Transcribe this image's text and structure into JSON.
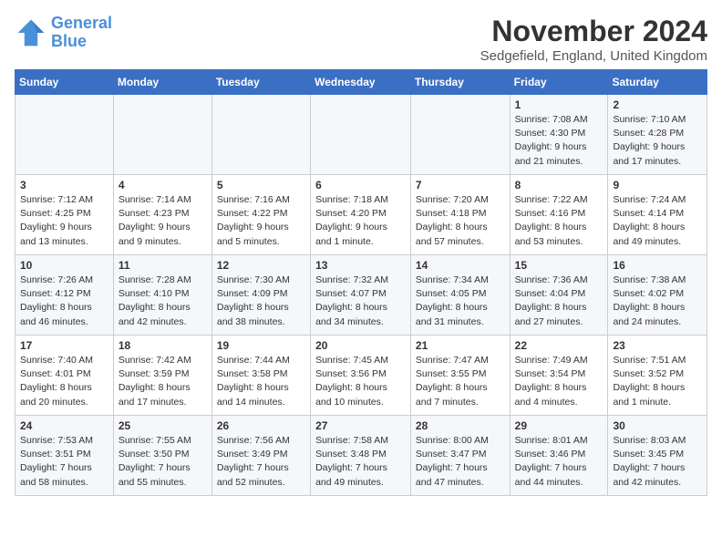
{
  "logo": {
    "line1": "General",
    "line2": "Blue"
  },
  "title": "November 2024",
  "location": "Sedgefield, England, United Kingdom",
  "days_header": [
    "Sunday",
    "Monday",
    "Tuesday",
    "Wednesday",
    "Thursday",
    "Friday",
    "Saturday"
  ],
  "weeks": [
    [
      {
        "day": "",
        "info": ""
      },
      {
        "day": "",
        "info": ""
      },
      {
        "day": "",
        "info": ""
      },
      {
        "day": "",
        "info": ""
      },
      {
        "day": "",
        "info": ""
      },
      {
        "day": "1",
        "info": "Sunrise: 7:08 AM\nSunset: 4:30 PM\nDaylight: 9 hours\nand 21 minutes."
      },
      {
        "day": "2",
        "info": "Sunrise: 7:10 AM\nSunset: 4:28 PM\nDaylight: 9 hours\nand 17 minutes."
      }
    ],
    [
      {
        "day": "3",
        "info": "Sunrise: 7:12 AM\nSunset: 4:25 PM\nDaylight: 9 hours\nand 13 minutes."
      },
      {
        "day": "4",
        "info": "Sunrise: 7:14 AM\nSunset: 4:23 PM\nDaylight: 9 hours\nand 9 minutes."
      },
      {
        "day": "5",
        "info": "Sunrise: 7:16 AM\nSunset: 4:22 PM\nDaylight: 9 hours\nand 5 minutes."
      },
      {
        "day": "6",
        "info": "Sunrise: 7:18 AM\nSunset: 4:20 PM\nDaylight: 9 hours\nand 1 minute."
      },
      {
        "day": "7",
        "info": "Sunrise: 7:20 AM\nSunset: 4:18 PM\nDaylight: 8 hours\nand 57 minutes."
      },
      {
        "day": "8",
        "info": "Sunrise: 7:22 AM\nSunset: 4:16 PM\nDaylight: 8 hours\nand 53 minutes."
      },
      {
        "day": "9",
        "info": "Sunrise: 7:24 AM\nSunset: 4:14 PM\nDaylight: 8 hours\nand 49 minutes."
      }
    ],
    [
      {
        "day": "10",
        "info": "Sunrise: 7:26 AM\nSunset: 4:12 PM\nDaylight: 8 hours\nand 46 minutes."
      },
      {
        "day": "11",
        "info": "Sunrise: 7:28 AM\nSunset: 4:10 PM\nDaylight: 8 hours\nand 42 minutes."
      },
      {
        "day": "12",
        "info": "Sunrise: 7:30 AM\nSunset: 4:09 PM\nDaylight: 8 hours\nand 38 minutes."
      },
      {
        "day": "13",
        "info": "Sunrise: 7:32 AM\nSunset: 4:07 PM\nDaylight: 8 hours\nand 34 minutes."
      },
      {
        "day": "14",
        "info": "Sunrise: 7:34 AM\nSunset: 4:05 PM\nDaylight: 8 hours\nand 31 minutes."
      },
      {
        "day": "15",
        "info": "Sunrise: 7:36 AM\nSunset: 4:04 PM\nDaylight: 8 hours\nand 27 minutes."
      },
      {
        "day": "16",
        "info": "Sunrise: 7:38 AM\nSunset: 4:02 PM\nDaylight: 8 hours\nand 24 minutes."
      }
    ],
    [
      {
        "day": "17",
        "info": "Sunrise: 7:40 AM\nSunset: 4:01 PM\nDaylight: 8 hours\nand 20 minutes."
      },
      {
        "day": "18",
        "info": "Sunrise: 7:42 AM\nSunset: 3:59 PM\nDaylight: 8 hours\nand 17 minutes."
      },
      {
        "day": "19",
        "info": "Sunrise: 7:44 AM\nSunset: 3:58 PM\nDaylight: 8 hours\nand 14 minutes."
      },
      {
        "day": "20",
        "info": "Sunrise: 7:45 AM\nSunset: 3:56 PM\nDaylight: 8 hours\nand 10 minutes."
      },
      {
        "day": "21",
        "info": "Sunrise: 7:47 AM\nSunset: 3:55 PM\nDaylight: 8 hours\nand 7 minutes."
      },
      {
        "day": "22",
        "info": "Sunrise: 7:49 AM\nSunset: 3:54 PM\nDaylight: 8 hours\nand 4 minutes."
      },
      {
        "day": "23",
        "info": "Sunrise: 7:51 AM\nSunset: 3:52 PM\nDaylight: 8 hours\nand 1 minute."
      }
    ],
    [
      {
        "day": "24",
        "info": "Sunrise: 7:53 AM\nSunset: 3:51 PM\nDaylight: 7 hours\nand 58 minutes."
      },
      {
        "day": "25",
        "info": "Sunrise: 7:55 AM\nSunset: 3:50 PM\nDaylight: 7 hours\nand 55 minutes."
      },
      {
        "day": "26",
        "info": "Sunrise: 7:56 AM\nSunset: 3:49 PM\nDaylight: 7 hours\nand 52 minutes."
      },
      {
        "day": "27",
        "info": "Sunrise: 7:58 AM\nSunset: 3:48 PM\nDaylight: 7 hours\nand 49 minutes."
      },
      {
        "day": "28",
        "info": "Sunrise: 8:00 AM\nSunset: 3:47 PM\nDaylight: 7 hours\nand 47 minutes."
      },
      {
        "day": "29",
        "info": "Sunrise: 8:01 AM\nSunset: 3:46 PM\nDaylight: 7 hours\nand 44 minutes."
      },
      {
        "day": "30",
        "info": "Sunrise: 8:03 AM\nSunset: 3:45 PM\nDaylight: 7 hours\nand 42 minutes."
      }
    ]
  ]
}
